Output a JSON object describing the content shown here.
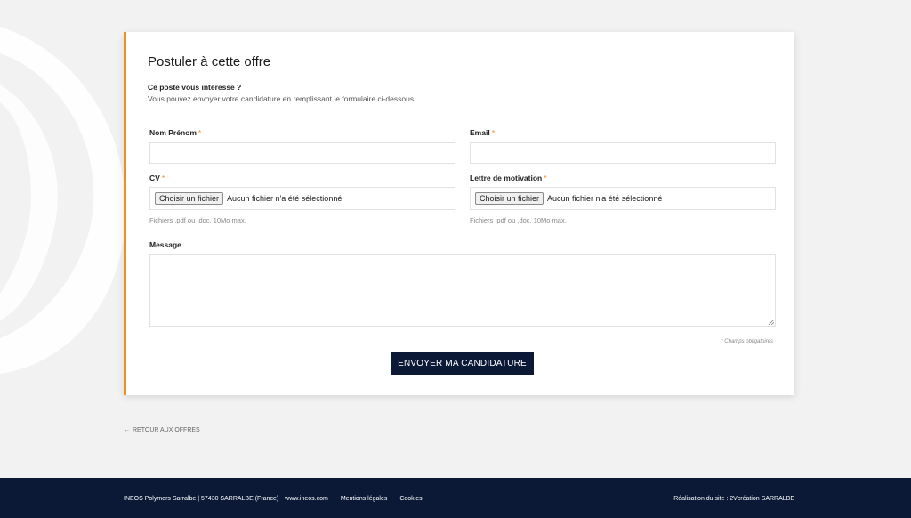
{
  "form": {
    "title": "Postuler à cette offre",
    "intro_question": "Ce poste vous intéresse ?",
    "intro_text": "Vous pouvez envoyer votre candidature en remplissant le formulaire ci-dessous.",
    "required_mark": "*",
    "name_label": "Nom Prénom",
    "email_label": "Email",
    "cv_label": "CV",
    "letter_label": "Lettre de motivation",
    "file_button": "Choisir un fichier",
    "file_none": "Aucun fichier n'a été sélectionné",
    "file_hint": "Fichiers .pdf ou .doc, 10Mo max.",
    "message_label": "Message",
    "required_note": "* Champs obligatoires",
    "submit_label": "ENVOYER MA CANDIDATURE"
  },
  "nav": {
    "back_arrow": "←",
    "back_label": "RETOUR AUX OFFRES"
  },
  "footer": {
    "address": "INEOS Polymers Sarralbe | 57430 SARRALBE (France)",
    "site_link": "www.ineos.com",
    "legal_link": "Mentions légales",
    "cookies_link": "Cookies",
    "credit": "Réalisation du site : 2Vcréation SARRALBE"
  },
  "colors": {
    "accent": "#f28c28",
    "navy": "#0b1937",
    "background": "#f2f2f2"
  }
}
